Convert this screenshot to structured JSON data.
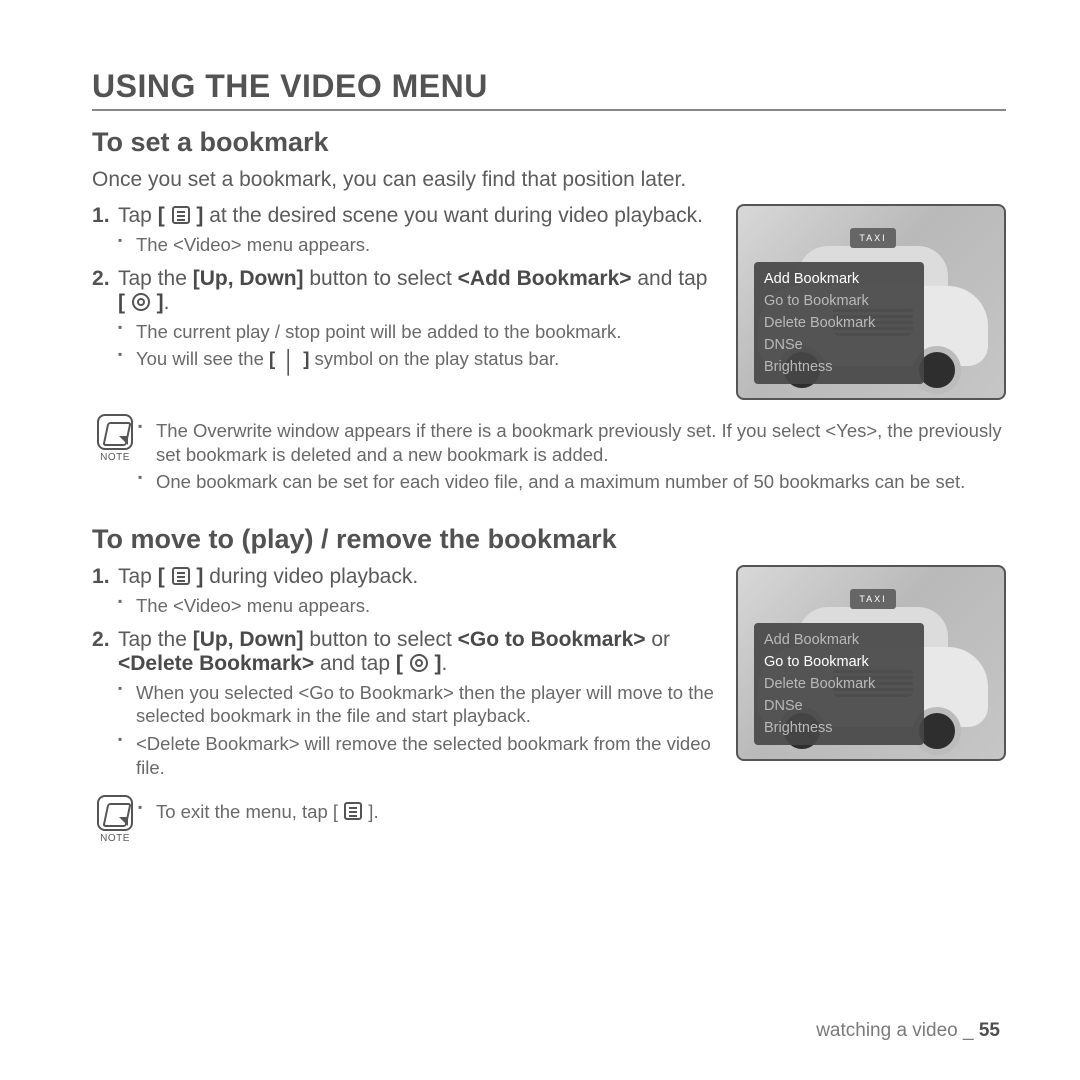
{
  "page_title": "USING THE VIDEO MENU",
  "section1": {
    "heading": "To set a bookmark",
    "intro": "Once you set a bookmark, you can easily find that position later.",
    "step1_a": "Tap ",
    "step1_b": " at the desired scene you want during video playback.",
    "step1_bullets": [
      "The <Video> menu appears."
    ],
    "step2_a": "Tap the ",
    "step2_b": "[Up, Down]",
    "step2_c": " button to select ",
    "step2_d": "<Add Bookmark>",
    "step2_e": " and tap ",
    "step2_f": ".",
    "step2_bullets_a": "The current play / stop point will be added to the bookmark.",
    "step2_bullets_b_pre": "You will see the ",
    "step2_bullets_b_post": " symbol on the play status bar.",
    "notes": [
      "The Overwrite window appears if there is a bookmark previously set. If you select <Yes>, the previously set bookmark is deleted and a new bookmark is added.",
      "One bookmark can be set for each video file, and a maximum number of 50 bookmarks can be set."
    ],
    "menu_items": [
      "Add Bookmark",
      "Go to Bookmark",
      "Delete Bookmark",
      "DNSe",
      "Brightness"
    ],
    "menu_selected_index": 0,
    "taxi_label": "TAXI"
  },
  "section2": {
    "heading": "To move to (play) / remove the bookmark",
    "step1_a": "Tap ",
    "step1_b": " during video playback.",
    "step1_bullets": [
      "The <Video> menu appears."
    ],
    "step2_a": "Tap the ",
    "step2_b": "[Up, Down]",
    "step2_c": " button to select ",
    "step2_d": "<Go to Bookmark>",
    "step2_e": " or ",
    "step2_f": "<Delete Bookmark>",
    "step2_g": " and tap ",
    "step2_h": ".",
    "step2_bullets": [
      "When you selected <Go to Bookmark> then the player will move to the selected bookmark in the file and start playback.",
      "<Delete Bookmark> will remove the selected bookmark from the video file."
    ],
    "note_pre": "To exit the menu, tap ",
    "note_post": ".",
    "menu_items": [
      "Add Bookmark",
      "Go to Bookmark",
      "Delete Bookmark",
      "DNSe",
      "Brightness"
    ],
    "menu_selected_index": 1,
    "taxi_label": "TAXI"
  },
  "note_label": "NOTE",
  "footer_text": "watching a video _ ",
  "page_number": "55"
}
